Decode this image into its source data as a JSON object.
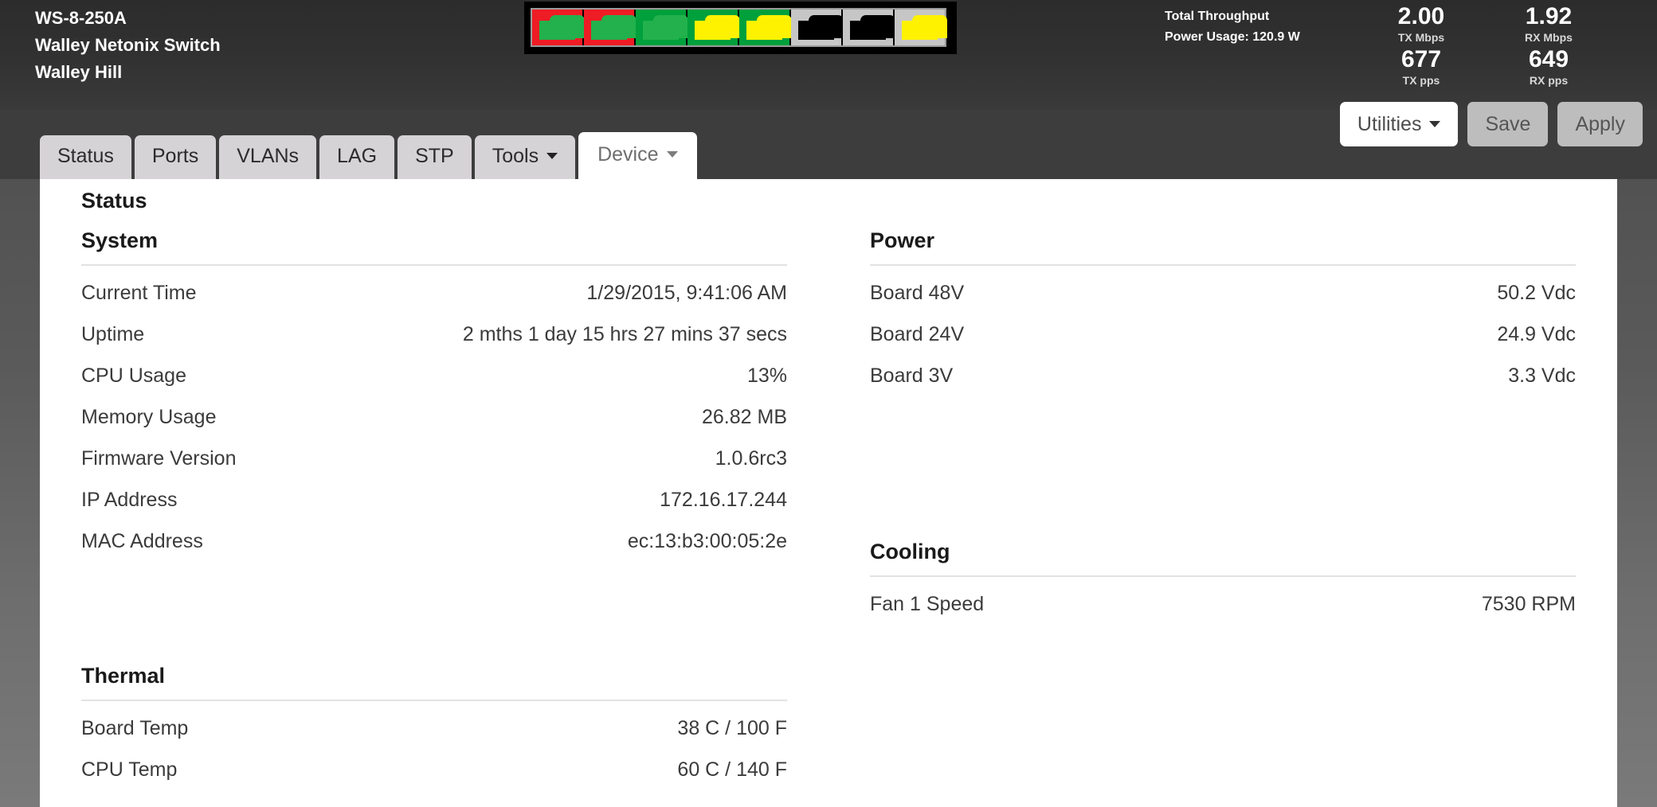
{
  "header": {
    "device_model": "WS-8-250A",
    "device_name": "Walley Netonix Switch",
    "device_location": "Walley Hill",
    "ports": [
      {
        "label": "Port 1",
        "frame_color": "#ee1c24",
        "jack_color": "#22b14c"
      },
      {
        "label": "Port 2",
        "frame_color": "#ee1c24",
        "jack_color": "#22b14c"
      },
      {
        "label": "Port 3",
        "frame_color": "#00a03c",
        "jack_color": "#22b14c"
      },
      {
        "label": "Port 4",
        "frame_color": "#00a03c",
        "jack_color": "#fff200"
      },
      {
        "label": "Port 5",
        "frame_color": "#00a03c",
        "jack_color": "#fff200"
      },
      {
        "label": "Port 6",
        "frame_color": "#c6c6c6",
        "jack_color": "#000000"
      },
      {
        "label": "Port 7",
        "frame_color": "#c6c6c6",
        "jack_color": "#000000"
      },
      {
        "label": "Port 8",
        "frame_color": "#c6c6c6",
        "jack_color": "#fff200"
      }
    ],
    "throughput_label": "Total Throughput",
    "power_usage_label": "Power Usage: 120.9 W",
    "stats": [
      {
        "value": "2.00",
        "unit": "TX Mbps"
      },
      {
        "value": "1.92",
        "unit": "RX Mbps"
      },
      {
        "value": "677",
        "unit": "TX pps"
      },
      {
        "value": "649",
        "unit": "RX pps"
      }
    ]
  },
  "nav": {
    "tabs": [
      {
        "label": "Status",
        "dropdown": false,
        "active": false
      },
      {
        "label": "Ports",
        "dropdown": false,
        "active": false
      },
      {
        "label": "VLANs",
        "dropdown": false,
        "active": false
      },
      {
        "label": "LAG",
        "dropdown": false,
        "active": false
      },
      {
        "label": "STP",
        "dropdown": false,
        "active": false
      },
      {
        "label": "Tools",
        "dropdown": true,
        "active": false
      },
      {
        "label": "Device",
        "dropdown": true,
        "active": true
      }
    ],
    "utilities_label": "Utilities",
    "save_label": "Save",
    "apply_label": "Apply"
  },
  "content": {
    "page_title": "Status",
    "sections": {
      "system": {
        "title": "System",
        "rows": [
          {
            "key": "Current Time",
            "value": "1/29/2015, 9:41:06 AM"
          },
          {
            "key": "Uptime",
            "value": "2 mths 1 day 15 hrs 27 mins 37 secs"
          },
          {
            "key": "CPU Usage",
            "value": "13%"
          },
          {
            "key": "Memory Usage",
            "value": "26.82 MB"
          },
          {
            "key": "Firmware Version",
            "value": "1.0.6rc3"
          },
          {
            "key": "IP Address",
            "value": "172.16.17.244"
          },
          {
            "key": "MAC Address",
            "value": "ec:13:b3:00:05:2e"
          }
        ]
      },
      "power": {
        "title": "Power",
        "rows": [
          {
            "key": "Board 48V",
            "value": "50.2 Vdc"
          },
          {
            "key": "Board 24V",
            "value": "24.9 Vdc"
          },
          {
            "key": "Board 3V",
            "value": "3.3 Vdc"
          }
        ]
      },
      "thermal": {
        "title": "Thermal",
        "rows": [
          {
            "key": "Board Temp",
            "value": "38 C / 100 F"
          },
          {
            "key": "CPU Temp",
            "value": "60 C / 140 F"
          }
        ]
      },
      "cooling": {
        "title": "Cooling",
        "rows": [
          {
            "key": "Fan 1 Speed",
            "value": "7530 RPM"
          }
        ]
      }
    }
  }
}
